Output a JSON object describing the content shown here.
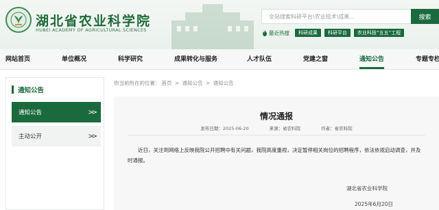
{
  "header": {
    "logo_cn": "湖北省农业科学院",
    "logo_en": "HUBEI ACADEMY OF AGRICULTURAL SCIENCES",
    "search_placeholder": "全站搜索科研平台\\农业技术\\成果...",
    "search_button": "搜索",
    "hot_label": "最近热搜",
    "hot_tags": [
      "科研成果",
      "科研平台",
      "农业科技“五五”工程"
    ]
  },
  "nav": {
    "items": [
      "网站首页",
      "单位概况",
      "科学研究",
      "成果转化与服务",
      "人才队伍",
      "党建之窗",
      "通知公告",
      "专题专栏"
    ],
    "active": "通知公告"
  },
  "sidebar": {
    "title": "通知公告",
    "items": [
      {
        "label": "通知公告",
        "arrow": ">>",
        "active": true
      },
      {
        "label": "主动公开",
        "arrow": ">>",
        "active": false
      }
    ]
  },
  "breadcrumb": {
    "prefix": "你当前所在的位置：",
    "items": [
      "首页",
      "通知公告",
      "通知公告"
    ],
    "separator": ">"
  },
  "article": {
    "title": "情况通报",
    "date": "发布日期：2025-06-20",
    "source": "来源：省农科院",
    "author": "作者：省农科院",
    "body": "近日，关注到网络上反映我院公开招聘中有关问题，我院高度重视，决定暂停相关岗位的招聘程序，依法依规启动调查，并及时通报。",
    "signature": "湖北省农业科学院",
    "sign_date": "2025年6月20日"
  },
  "colors": {
    "primary": "#1a6a3e",
    "nav_bg": "#f5f8f6",
    "content_bg": "#f6f7f6"
  }
}
